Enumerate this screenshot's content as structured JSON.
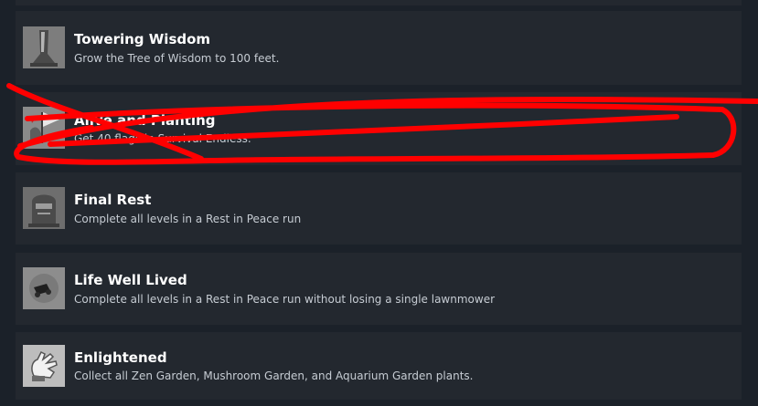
{
  "achievements": [
    {
      "title": "Towering Wisdom",
      "description": "Grow the Tree of Wisdom to 100 feet.",
      "icon": "tree-icon"
    },
    {
      "title": "Alive and Planting",
      "description": "Get 40 flags in Survival Endless.",
      "icon": "zombie-hand-flag-icon"
    },
    {
      "title": "Final Rest",
      "description": "Complete all levels in a Rest in Peace run",
      "icon": "tombstone-icon"
    },
    {
      "title": "Life Well Lived",
      "description": "Complete all levels in a Rest in Peace run without losing a single lawnmower",
      "icon": "lawnmower-icon"
    },
    {
      "title": "Enlightened",
      "description": "Collect all Zen Garden, Mushroom Garden, and Aquarium Garden plants.",
      "icon": "glove-hand-icon"
    }
  ],
  "colors": {
    "background": "#1b2129",
    "row": "#23282f",
    "title": "#ffffff",
    "description": "#c6ccd3",
    "scribble": "#ff0000"
  }
}
